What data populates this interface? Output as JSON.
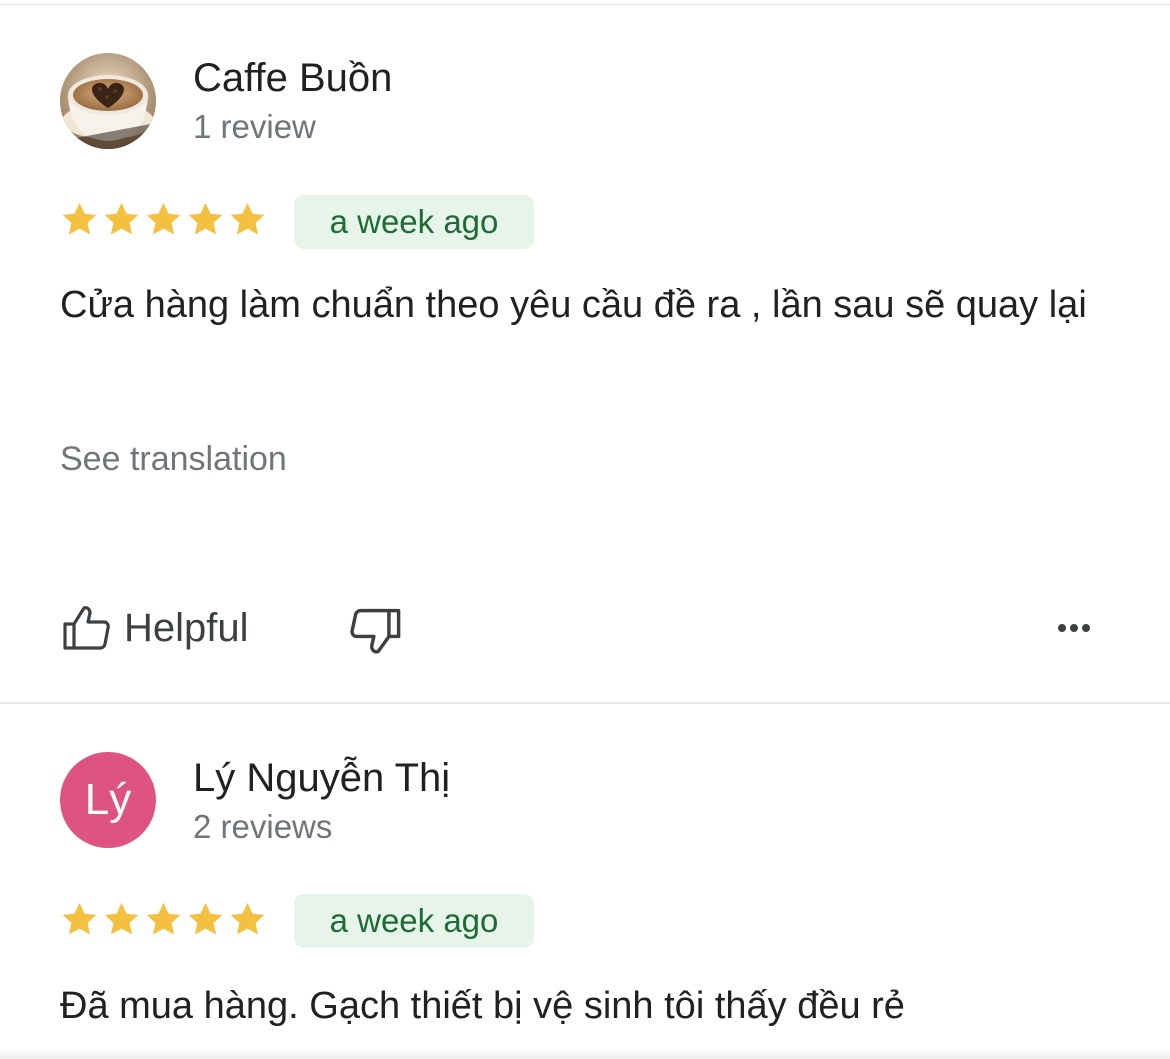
{
  "colors": {
    "star": "#f4c03f",
    "badge_bg": "#e6f4ea",
    "badge_text": "#1e6b34",
    "avatar_ly": "#dd5381",
    "secondary_text": "#70757a"
  },
  "reviews": [
    {
      "reviewer": "Caffe Buồn",
      "review_count": "1 review",
      "avatar": "coffee-cup-photo",
      "rating": 5,
      "date": "a week ago",
      "text": "Cửa hàng làm chuẩn theo yêu cầu đề ra , lần sau sẽ quay lại",
      "see_translation": "See translation",
      "helpful_label": "Helpful"
    },
    {
      "reviewer": "Lý Nguyễn Thị",
      "review_count": "2 reviews",
      "avatar_initials": "Lý",
      "rating": 5,
      "date": "a week ago",
      "text": "Đã mua hàng. Gạch thiết bị vệ sinh tôi thấy đều rẻ"
    }
  ],
  "icons": {
    "thumbs_up": "thumbs-up-icon",
    "thumbs_down": "thumbs-down-icon",
    "more": "more-horizontal-icon",
    "star": "star-icon"
  }
}
